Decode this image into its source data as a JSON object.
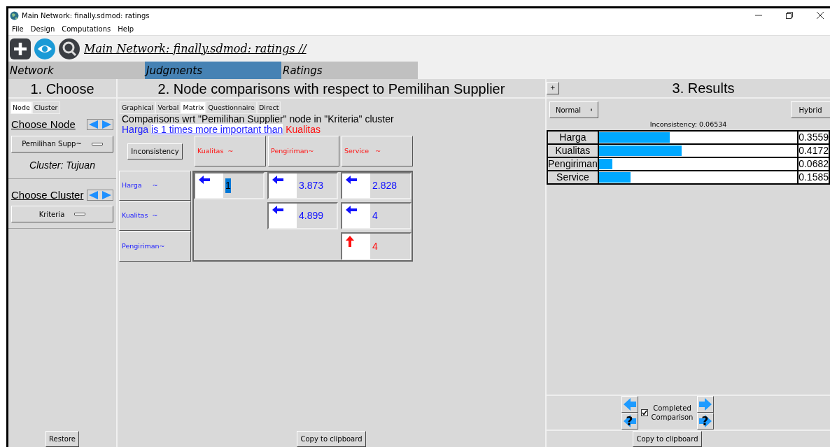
{
  "window": {
    "title": "Main Network: finally.sdmod: ratings"
  },
  "menu": [
    "File",
    "Design",
    "Computations",
    "Help"
  ],
  "toolbar": {
    "path": "Main Network: finally.sdmod: ratings //"
  },
  "mode_tabs": [
    {
      "label": "Network",
      "selected": false
    },
    {
      "label": "Judgments",
      "selected": true
    },
    {
      "label": "Ratings",
      "selected": false
    }
  ],
  "choose": {
    "title": "1. Choose",
    "tabs": [
      {
        "label": "Node",
        "selected": true
      },
      {
        "label": "Cluster",
        "selected": false
      }
    ],
    "node_label": "Choose Node",
    "node_value": "Pemilihan Supp~",
    "cluster_info": "Cluster: Tujuan",
    "cluster_label": "Choose Cluster",
    "cluster_value": "Kriteria",
    "restore": "Restore"
  },
  "comparisons": {
    "title": "2. Node comparisons with respect to Pemilihan Supplier",
    "tabs": [
      {
        "label": "Graphical",
        "selected": false
      },
      {
        "label": "Verbal",
        "selected": false
      },
      {
        "label": "Matrix",
        "selected": true
      },
      {
        "label": "Questionnaire",
        "selected": false
      },
      {
        "label": "Direct",
        "selected": false
      }
    ],
    "wrt": "Comparisons wrt \"Pemilihan Supplier\" node in \"Kriteria\" cluster",
    "statement": [
      {
        "kind": "row",
        "text": "Harga"
      },
      {
        "kind": "link",
        "text": "is 1 times more important than"
      },
      {
        "kind": "column",
        "text": "Kualitas"
      }
    ],
    "inconsistency_button": "Inconsistency",
    "columns": [
      "Kualitas  ~",
      "Pengiriman~",
      "Service   ~"
    ],
    "rows": [
      {
        "label": "Harga     ~",
        "cells": [
          {
            "kind": "row-favored",
            "value": "1",
            "selected": true
          },
          {
            "kind": "row-favored",
            "value": "3.873",
            "selected": false
          },
          {
            "kind": "row-favored",
            "value": "2.828",
            "selected": false
          }
        ]
      },
      {
        "label": "Kualitas  ~",
        "cells": [
          null,
          {
            "kind": "row-favored",
            "value": "4.899",
            "selected": false
          },
          {
            "kind": "row-favored",
            "value": "4",
            "selected": false
          }
        ]
      },
      {
        "label": "Pengiriman~",
        "cells": [
          null,
          null,
          {
            "kind": "column-favored",
            "value": "4",
            "selected": false
          }
        ]
      }
    ],
    "copy": "Copy to clipboard"
  },
  "results": {
    "expand": "+",
    "title": "3. Results",
    "mode": "Normal",
    "view": "Hybrid",
    "inconsistency": "Inconsistency: 0.06534",
    "items": [
      {
        "name": "Harga",
        "level": 0.3559,
        "value": "0.3559"
      },
      {
        "name": "Kualitas",
        "level": 0.4172,
        "value": "0.4172"
      },
      {
        "name": "Pengiriman",
        "level": 0.0682,
        "value": "0.0682"
      },
      {
        "name": "Service",
        "level": 0.1585,
        "value": "0.1585"
      }
    ],
    "nav": [
      {
        "kind": "previous"
      },
      {
        "kind": "next"
      },
      {
        "kind": "previous-unfinished",
        "label": "?"
      },
      {
        "kind": "next-unfinished",
        "label": "?"
      }
    ],
    "completed": {
      "label": "Completed Comparison",
      "checked": true
    },
    "copy": "Copy to clipboard"
  }
}
